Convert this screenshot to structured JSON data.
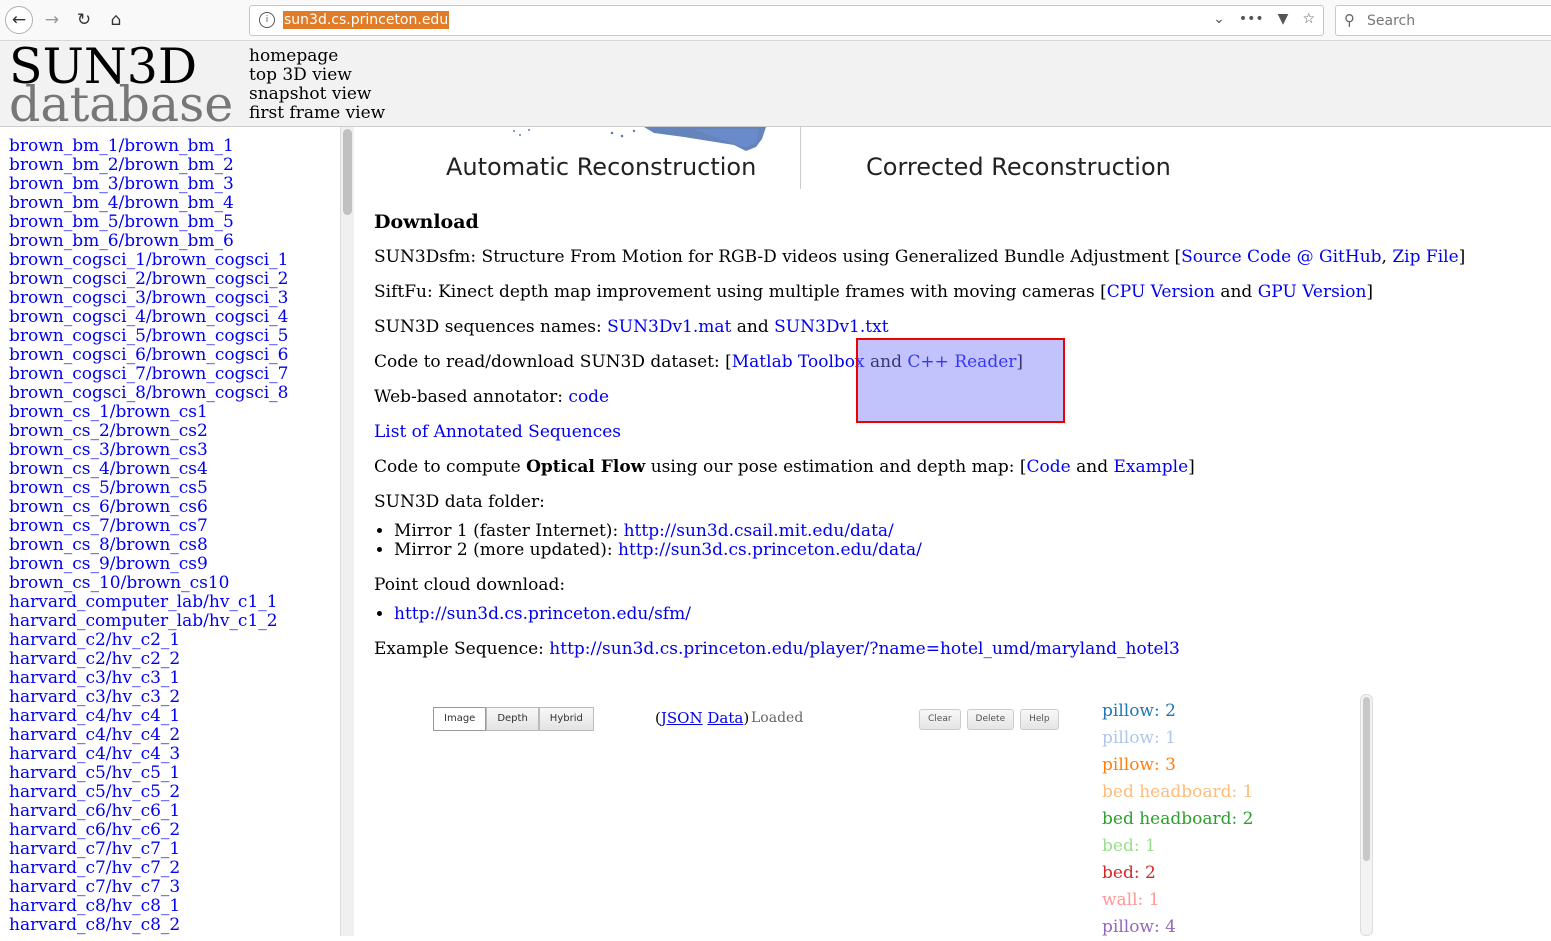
{
  "browser": {
    "url": "sun3d.cs.princeton.edu",
    "search_placeholder": "Search"
  },
  "header": {
    "logo_line1": "SUN3D",
    "logo_line2": "database",
    "nav": [
      "homepage",
      "top 3D view",
      "snapshot view",
      "first frame view"
    ]
  },
  "sidebar": {
    "items": [
      "brown_bm_1/brown_bm_1",
      "brown_bm_2/brown_bm_2",
      "brown_bm_3/brown_bm_3",
      "brown_bm_4/brown_bm_4",
      "brown_bm_5/brown_bm_5",
      "brown_bm_6/brown_bm_6",
      "brown_cogsci_1/brown_cogsci_1",
      "brown_cogsci_2/brown_cogsci_2",
      "brown_cogsci_3/brown_cogsci_3",
      "brown_cogsci_4/brown_cogsci_4",
      "brown_cogsci_5/brown_cogsci_5",
      "brown_cogsci_6/brown_cogsci_6",
      "brown_cogsci_7/brown_cogsci_7",
      "brown_cogsci_8/brown_cogsci_8",
      "brown_cs_1/brown_cs1",
      "brown_cs_2/brown_cs2",
      "brown_cs_3/brown_cs3",
      "brown_cs_4/brown_cs4",
      "brown_cs_5/brown_cs5",
      "brown_cs_6/brown_cs6",
      "brown_cs_7/brown_cs7",
      "brown_cs_8/brown_cs8",
      "brown_cs_9/brown_cs9",
      "brown_cs_10/brown_cs10",
      "harvard_computer_lab/hv_c1_1",
      "harvard_computer_lab/hv_c1_2",
      "harvard_c2/hv_c2_1",
      "harvard_c2/hv_c2_2",
      "harvard_c3/hv_c3_1",
      "harvard_c3/hv_c3_2",
      "harvard_c4/hv_c4_1",
      "harvard_c4/hv_c4_2",
      "harvard_c4/hv_c4_3",
      "harvard_c5/hv_c5_1",
      "harvard_c5/hv_c5_2",
      "harvard_c6/hv_c6_1",
      "harvard_c6/hv_c6_2",
      "harvard_c7/hv_c7_1",
      "harvard_c7/hv_c7_2",
      "harvard_c7/hv_c7_3",
      "harvard_c8/hv_c8_1",
      "harvard_c8/hv_c8_2"
    ]
  },
  "banner": {
    "left_label": "Automatic Reconstruction",
    "right_label": "Corrected Reconstruction"
  },
  "download": {
    "title": "Download",
    "sfm": {
      "text": "SUN3Dsfm: Structure From Motion for RGB-D videos using Generalized Bundle Adjustment [",
      "link1": "Source Code @ GitHub",
      "sep": ", ",
      "link2": "Zip File",
      "end": "]"
    },
    "siftfu": {
      "text": "SiftFu: Kinect depth map improvement using multiple frames with moving cameras [",
      "link1": "CPU Version",
      "sep": " and ",
      "link2": "GPU Version",
      "end": "]"
    },
    "names": {
      "text": "SUN3D sequences names: ",
      "link1": "SUN3Dv1.mat",
      "sep": " and ",
      "link2": "SUN3Dv1.txt"
    },
    "reader": {
      "text": "Code to read/download SUN3D dataset: [",
      "link1": "Matlab Toolbox",
      "sep": " and ",
      "link2": "C++ Reader",
      "end": "]"
    },
    "annotator": {
      "text": "Web-based annotator: ",
      "link": "code"
    },
    "annotated_list": "List of Annotated Sequences",
    "flow": {
      "text1": "Code to compute ",
      "bold": "Optical Flow",
      "text2": " using our pose estimation and depth map: [",
      "link1": "Code",
      "sep": " and ",
      "link2": "Example",
      "end": "]"
    },
    "folder_title": "SUN3D data folder:",
    "mirrors": [
      {
        "label": "Mirror 1 (faster Internet): ",
        "link": "http://sun3d.csail.mit.edu/data/"
      },
      {
        "label": "Mirror 2 (more updated): ",
        "link": "http://sun3d.cs.princeton.edu/data/"
      }
    ],
    "pointcloud_title": "Point cloud download:",
    "pointcloud_link": "http://sun3d.cs.princeton.edu/sfm/",
    "example": {
      "text": "Example Sequence: ",
      "link": "http://sun3d.cs.princeton.edu/player/?name=hotel_umd/maryland_hotel3"
    }
  },
  "viewer": {
    "mode_buttons": [
      "Image",
      "Depth",
      "Hybrid"
    ],
    "json_open": "(",
    "json_link": "JSON",
    "data_link": "Data",
    "json_close": ")",
    "status": "Loaded",
    "tool_buttons": [
      "Clear",
      "Delete",
      "Help"
    ],
    "labels": [
      {
        "text": "pillow: 2",
        "color": "#1f77b4"
      },
      {
        "text": "pillow: 1",
        "color": "#aec7e8"
      },
      {
        "text": "pillow: 3",
        "color": "#ff7f0e"
      },
      {
        "text": "bed headboard: 1",
        "color": "#ffbb78"
      },
      {
        "text": "bed headboard: 2",
        "color": "#2ca02c"
      },
      {
        "text": "bed: 1",
        "color": "#98df8a"
      },
      {
        "text": "bed: 2",
        "color": "#d62728"
      },
      {
        "text": "wall: 1",
        "color": "#ff9896"
      },
      {
        "text": "pillow: 4",
        "color": "#9467bd"
      }
    ]
  }
}
